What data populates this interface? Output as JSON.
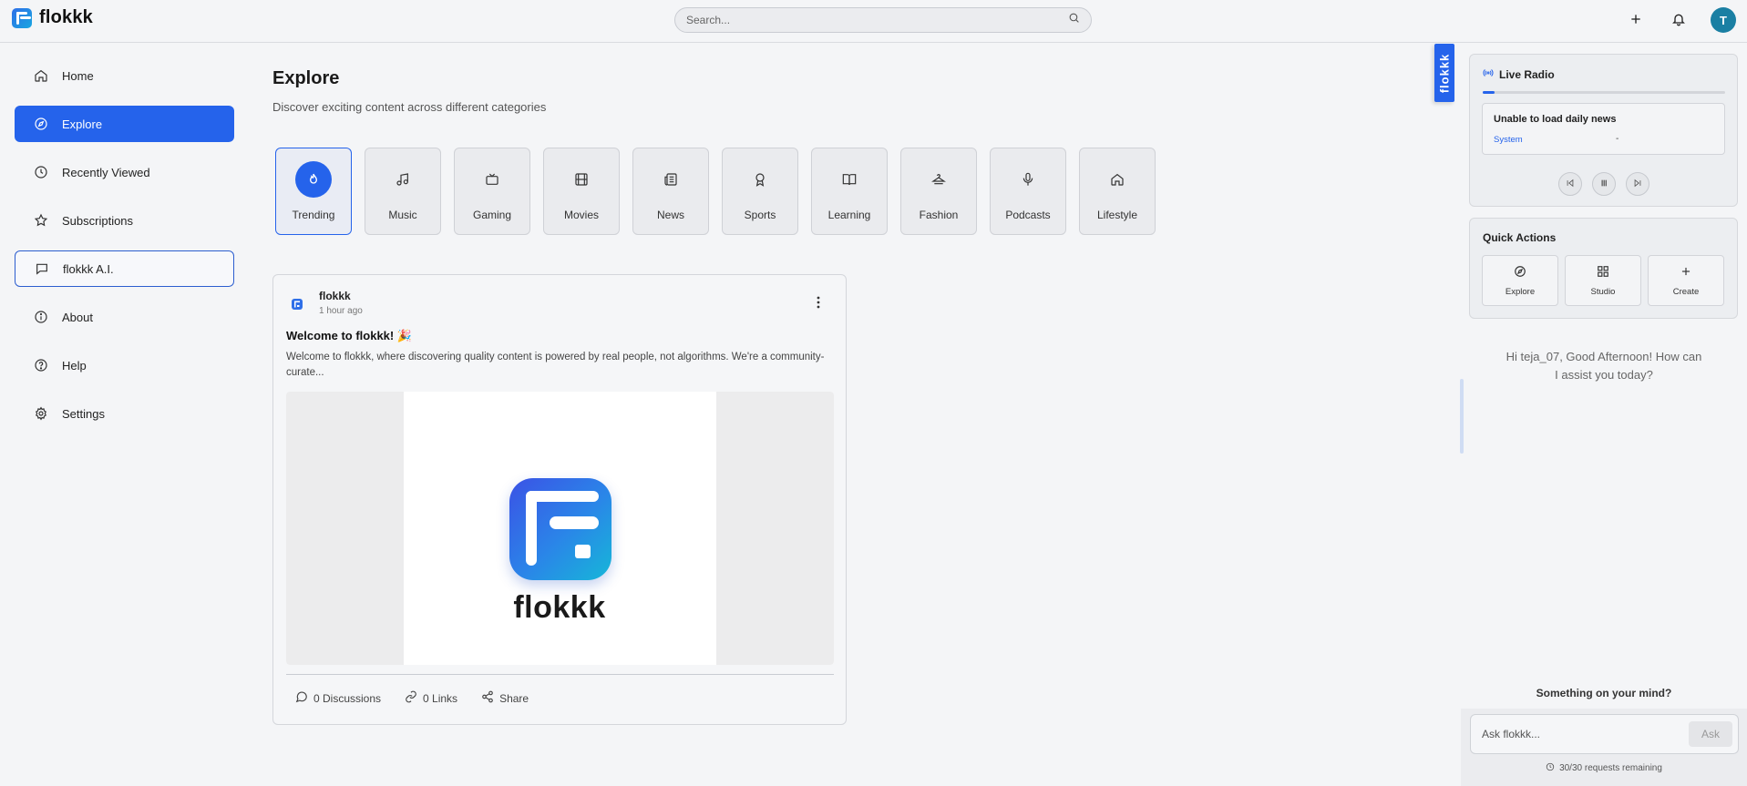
{
  "app": {
    "name": "flokkk",
    "accent": "#2563eb"
  },
  "header": {
    "search_placeholder": "Search...",
    "avatar_initial": "T"
  },
  "sidebar": {
    "items": [
      {
        "label": "Home",
        "icon": "home-icon"
      },
      {
        "label": "Explore",
        "icon": "compass-icon",
        "active": true
      },
      {
        "label": "Recently Viewed",
        "icon": "clock-icon"
      },
      {
        "label": "Subscriptions",
        "icon": "star-icon"
      },
      {
        "label": "flokkk A.I.",
        "icon": "chat-icon"
      },
      {
        "label": "About",
        "icon": "info-icon"
      },
      {
        "label": "Help",
        "icon": "help-icon"
      },
      {
        "label": "Settings",
        "icon": "gear-icon"
      }
    ]
  },
  "main": {
    "title": "Explore",
    "subtitle": "Discover exciting content across different categories",
    "categories": [
      {
        "label": "Trending",
        "icon": "flame-icon",
        "active": true
      },
      {
        "label": "Music",
        "icon": "music-icon"
      },
      {
        "label": "Gaming",
        "icon": "tv-icon"
      },
      {
        "label": "Movies",
        "icon": "film-icon"
      },
      {
        "label": "News",
        "icon": "newspaper-icon"
      },
      {
        "label": "Sports",
        "icon": "award-icon"
      },
      {
        "label": "Learning",
        "icon": "book-icon"
      },
      {
        "label": "Fashion",
        "icon": "hanger-icon"
      },
      {
        "label": "Podcasts",
        "icon": "mic-icon"
      },
      {
        "label": "Lifestyle",
        "icon": "house-icon"
      }
    ]
  },
  "post": {
    "author": "flokkk",
    "time": "1 hour ago",
    "title": "Welcome to flokkk! 🎉",
    "body": "Welcome to flokkk, where discovering quality content is powered by real people, not algorithms. We're a community-curate...",
    "media_wordmark": "flokkk",
    "discussions": "0 Discussions",
    "links": "0 Links",
    "share": "Share"
  },
  "vertical_tab": {
    "label": "flokkk"
  },
  "radio": {
    "title": "Live Radio",
    "progress": 0.05,
    "news_title": "Unable to load daily news",
    "news_source": "System",
    "news_dash": "-"
  },
  "quick_actions": {
    "title": "Quick Actions",
    "items": [
      {
        "label": "Explore",
        "icon": "compass-icon"
      },
      {
        "label": "Studio",
        "icon": "grid-icon"
      },
      {
        "label": "Create",
        "icon": "plus-icon"
      }
    ]
  },
  "assistant": {
    "greeting": "Hi teja_07, Good Afternoon! How can I assist you today?",
    "prompt": "Something on your mind?",
    "input_placeholder": "Ask flokkk...",
    "ask_label": "Ask",
    "requests": "30/30 requests remaining"
  }
}
